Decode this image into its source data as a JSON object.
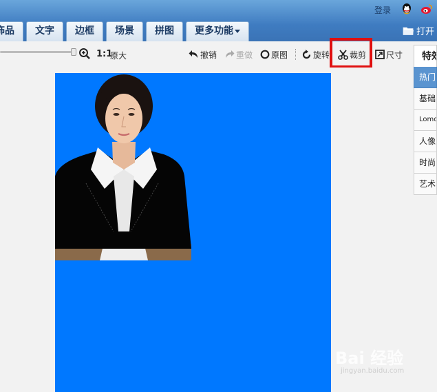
{
  "header": {
    "login_label": "登录",
    "tabs": [
      "饰品",
      "文字",
      "边框",
      "场景",
      "拼图",
      "更多功能"
    ],
    "open_label": "打开"
  },
  "toolbar": {
    "ratio_label": "1:1",
    "original_size_label": "原大",
    "undo_label": "撤销",
    "redo_label": "重做",
    "original_label": "原图",
    "rotate_label": "旋转",
    "crop_label": "裁剪",
    "size_label": "尺寸"
  },
  "canvas": {
    "background_color": "#0078ff"
  },
  "panel": {
    "title": "特效",
    "categories": [
      "热门",
      "基础",
      "Lomo",
      "人像",
      "时尚",
      "艺术"
    ],
    "active_index": 0
  },
  "watermark": {
    "logo": "Bai 经验",
    "url": "jingyan.baidu.com"
  }
}
